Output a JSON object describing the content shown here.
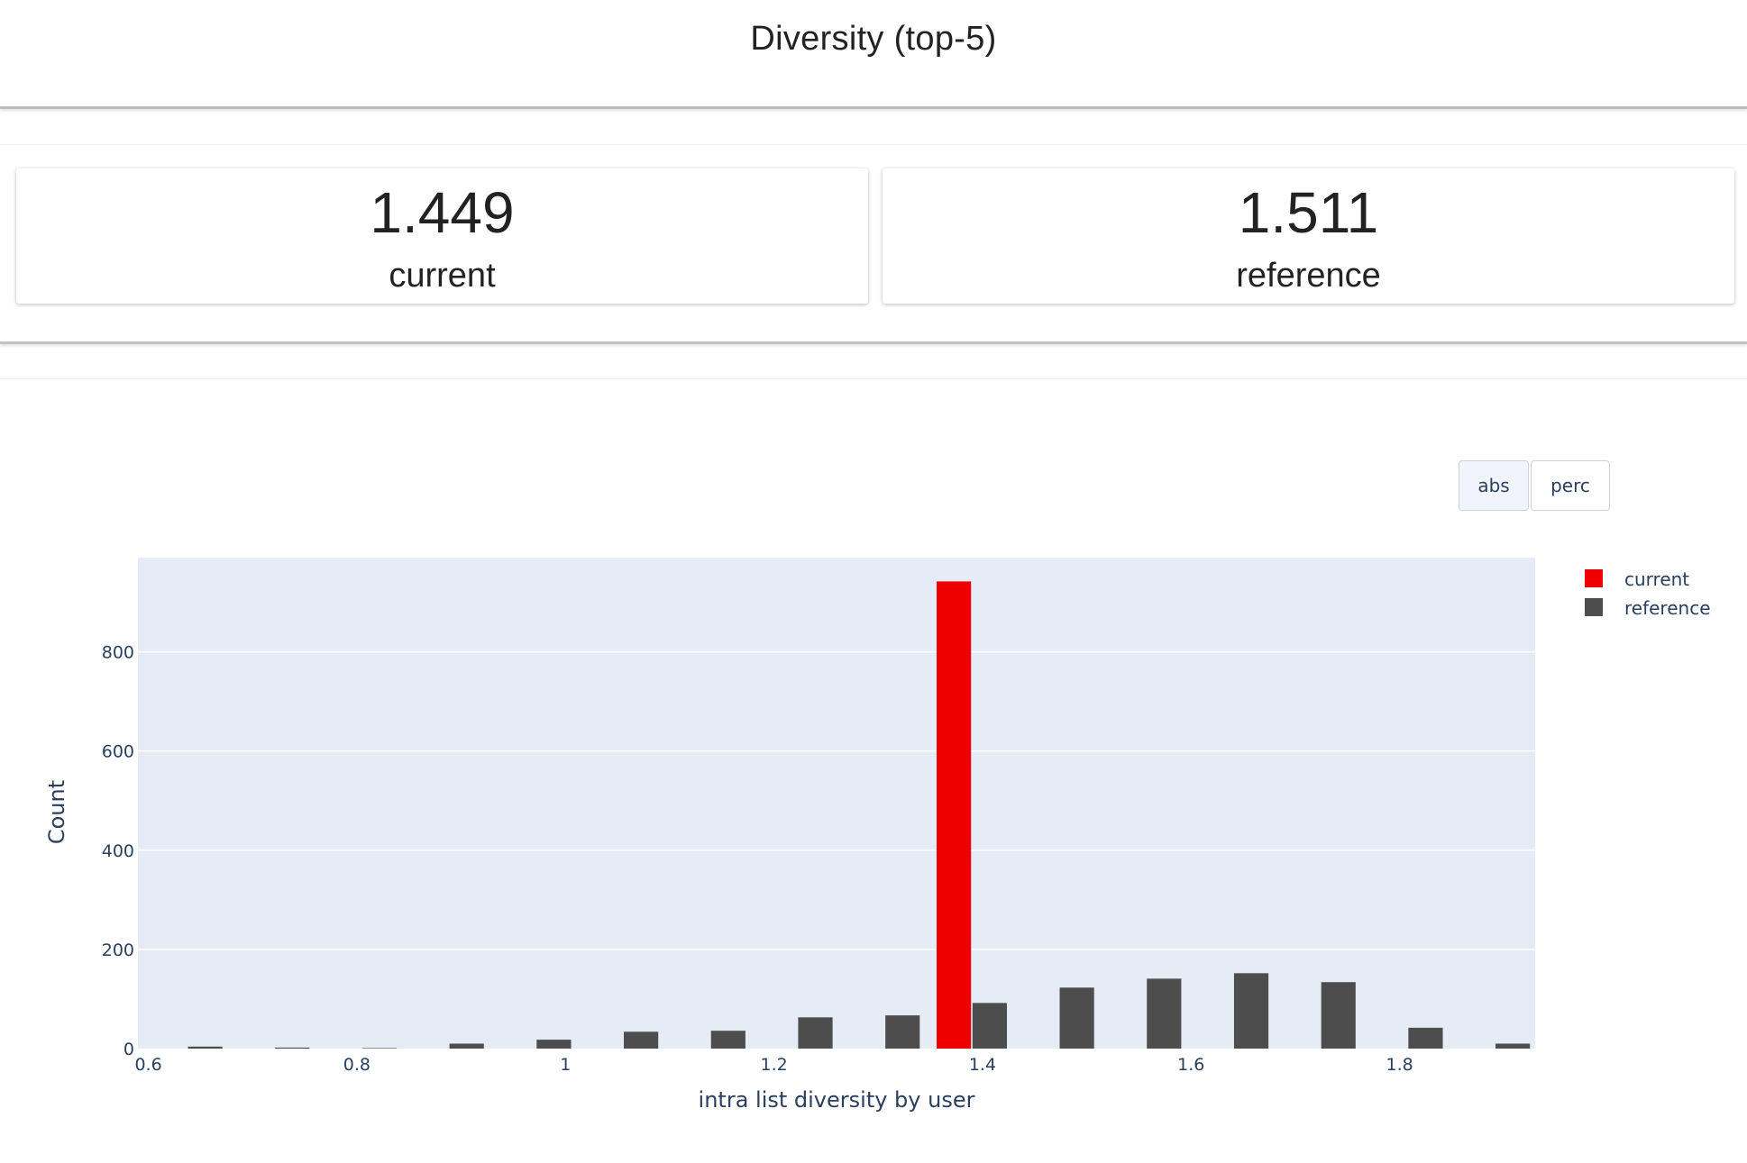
{
  "header": {
    "title": "Diversity (top-5)"
  },
  "counters": [
    {
      "value": "1.449",
      "label": "current"
    },
    {
      "value": "1.511",
      "label": "reference"
    }
  ],
  "controls": {
    "abs_label": "abs",
    "perc_label": "perc"
  },
  "chart_data": {
    "type": "bar",
    "title": "",
    "xlabel": "intra list diversity by user",
    "ylabel": "Count",
    "xlim": [
      0.59,
      1.93
    ],
    "ylim": [
      0,
      990
    ],
    "x_ticks": [
      "0.6",
      "0.8",
      "1",
      "1.2",
      "1.4",
      "1.6",
      "1.8"
    ],
    "x_tick_values": [
      0.6,
      0.8,
      1.0,
      1.2,
      1.4,
      1.6,
      1.8
    ],
    "y_ticks": [
      "0",
      "200",
      "400",
      "600",
      "800"
    ],
    "y_tick_values": [
      0,
      200,
      400,
      600,
      800
    ],
    "bar_width": 0.033,
    "grid": true,
    "legend_position": "top-right",
    "colors": {
      "current": "#ee0000",
      "reference": "#4d4d4d",
      "plot_bg": "#e5ecf6",
      "grid": "#ffffff",
      "text": "#2a3f5f"
    },
    "series": [
      {
        "name": "current",
        "x": [
          1.3725
        ],
        "values": [
          942
        ]
      },
      {
        "name": "reference",
        "x": [
          0.6545,
          0.7381,
          0.8217,
          0.9053,
          0.9889,
          1.0725,
          1.1561,
          1.2397,
          1.3233,
          1.4069,
          1.4905,
          1.5741,
          1.6577,
          1.7413,
          1.8249,
          1.9085
        ],
        "values": [
          4,
          2,
          1,
          10,
          18,
          34,
          36,
          63,
          67,
          92,
          123,
          141,
          152,
          134,
          42,
          10
        ]
      }
    ]
  }
}
